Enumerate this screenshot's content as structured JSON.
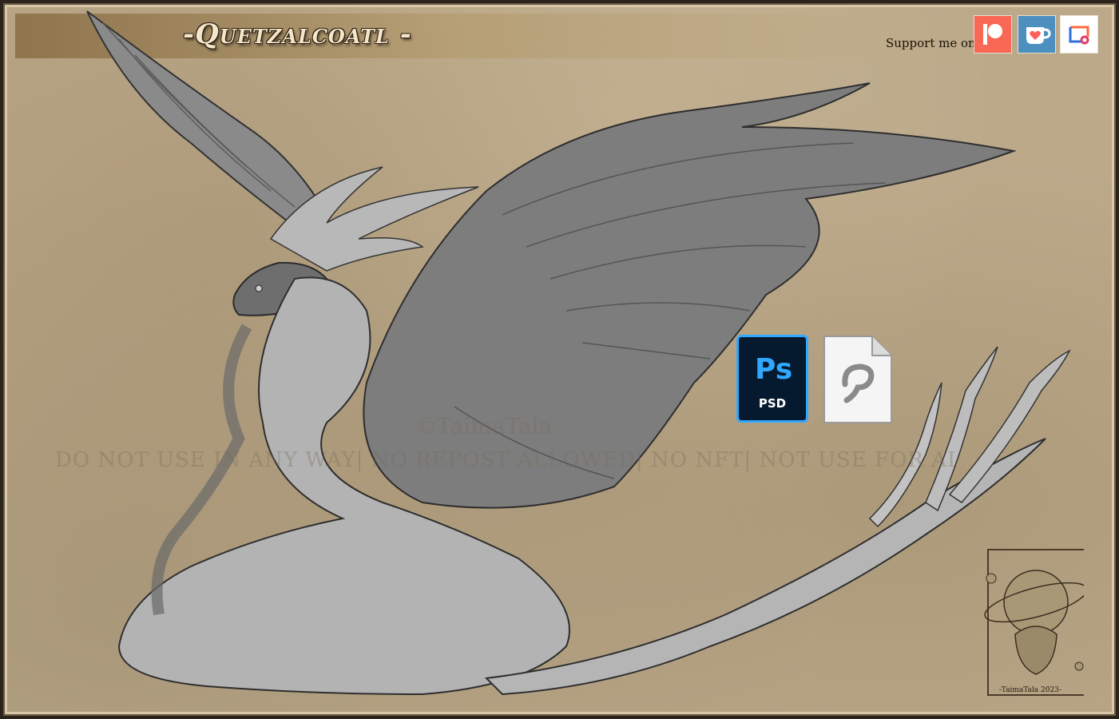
{
  "header": {
    "title": "-Quetzalcoatl -",
    "support_label": "Support me on:",
    "support_links": [
      "patreon",
      "ko-fi",
      "other"
    ]
  },
  "watermark": {
    "credit": "©TaimaTala",
    "line": "DO NOT USE IN ANY WAY| NO REPOST ALLOWED| NO NFT| NOT USE FOR AI"
  },
  "file_formats": {
    "psd_glyph": "Ps",
    "psd_label": "PSD",
    "clip_icon": "clip-studio-file-icon"
  },
  "signature_badge": {
    "caption": "-TaimaTala 2023-"
  },
  "colors": {
    "background": "#bba98a",
    "frame": "#2c241c",
    "patreon": "#f96854",
    "kofi": "#4d8fbf",
    "photoshop": "#31a8ff"
  }
}
